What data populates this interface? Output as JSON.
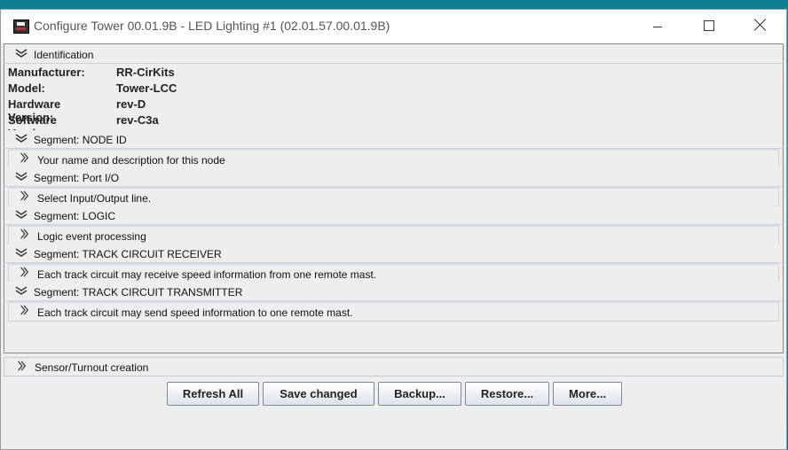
{
  "window": {
    "title": "Configure Tower 00.01.9B - LED Lighting #1 (02.01.57.00.01.9B)"
  },
  "identification": {
    "header": "Identification",
    "fields": [
      {
        "key": "Manufacturer:",
        "value": "RR-CirKits"
      },
      {
        "key": "Model:",
        "value": "Tower-LCC"
      },
      {
        "key": "Hardware Version:",
        "value": "rev-D"
      },
      {
        "key": "Software Version:",
        "value": "rev-C3a"
      }
    ]
  },
  "segments": [
    {
      "title": "Segment: NODE ID",
      "description": "Your name and description for this node"
    },
    {
      "title": "Segment: Port I/O",
      "description": "Select Input/Output line."
    },
    {
      "title": "Segment: LOGIC",
      "description": "Logic event processing"
    },
    {
      "title": "Segment: TRACK CIRCUIT RECEIVER",
      "description": "Each track circuit may receive speed information from one remote mast."
    },
    {
      "title": "Segment: TRACK CIRCUIT TRANSMITTER",
      "description": "Each track circuit may send speed information to one remote mast."
    }
  ],
  "sensor": {
    "label": "Sensor/Turnout creation"
  },
  "buttons": {
    "refresh": "Refresh All",
    "save": "Save changed",
    "backup": "Backup...",
    "restore": "Restore...",
    "more": "More..."
  }
}
